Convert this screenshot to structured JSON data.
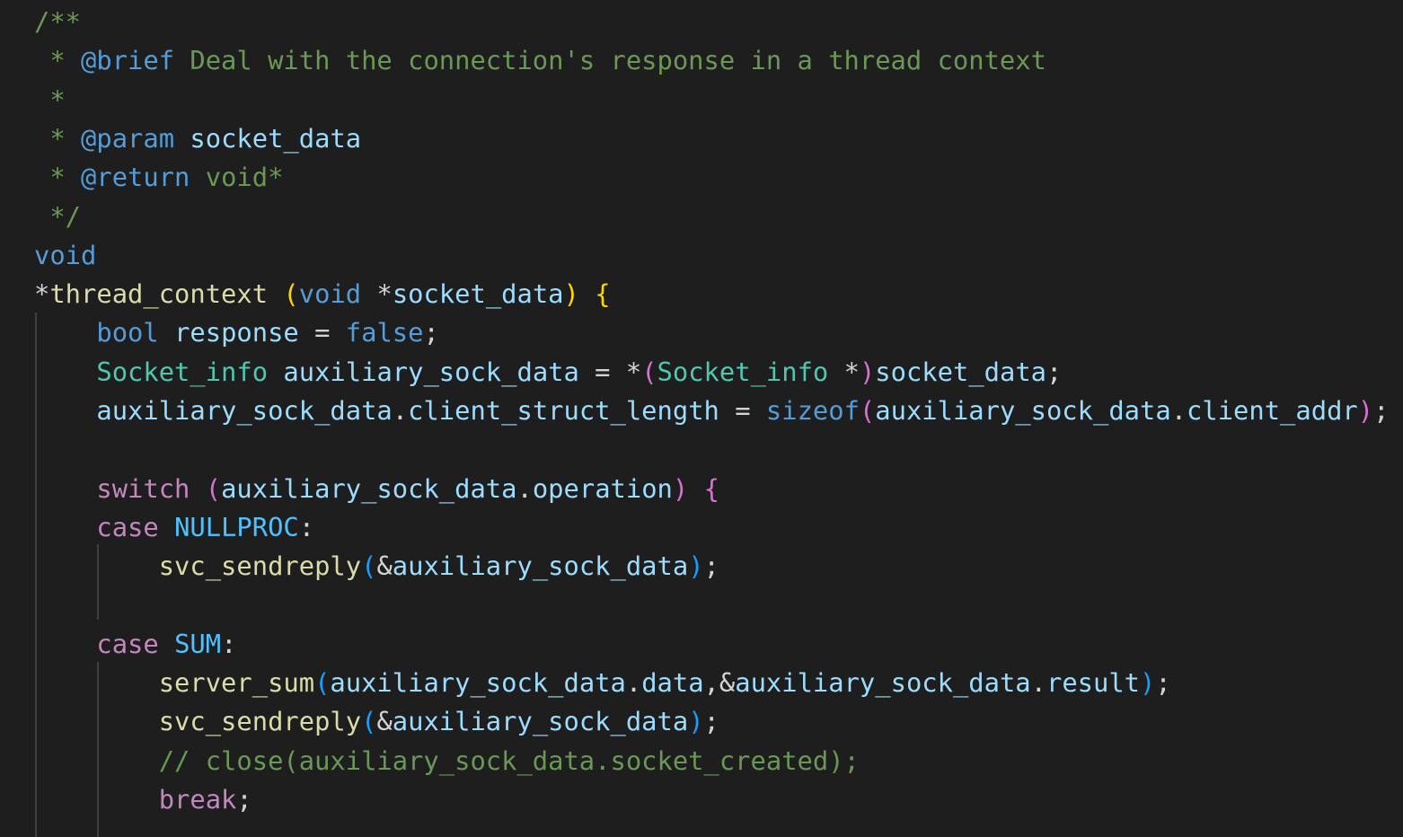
{
  "editor": {
    "colors": {
      "background": "#1e1e1e",
      "comment": "#6a9955",
      "doc_tag": "#569cd6",
      "doc_param": "#9cdcfe",
      "keyword": "#569cd6",
      "control": "#c586c0",
      "type": "#4ec9b0",
      "function": "#dcdcaa",
      "variable": "#9cdcfe",
      "constant": "#4fc1ff",
      "punctuation": "#d4d4d4",
      "bracket_gold": "#ffd700",
      "bracket_purple": "#da70d6",
      "bracket_blue": "#179fff",
      "indent_guide": "#404040"
    },
    "lines": [
      [
        {
          "t": "/**",
          "c": "comment"
        }
      ],
      [
        {
          "t": " * ",
          "c": "comment"
        },
        {
          "t": "@brief",
          "c": "doc_tag"
        },
        {
          "t": " Deal with the connection's response in a thread context",
          "c": "comment"
        }
      ],
      [
        {
          "t": " *",
          "c": "comment"
        }
      ],
      [
        {
          "t": " * ",
          "c": "comment"
        },
        {
          "t": "@param",
          "c": "doc_tag"
        },
        {
          "t": " ",
          "c": "comment"
        },
        {
          "t": "socket_data",
          "c": "doc_param"
        }
      ],
      [
        {
          "t": " * ",
          "c": "comment"
        },
        {
          "t": "@return",
          "c": "doc_tag"
        },
        {
          "t": " void*",
          "c": "comment"
        }
      ],
      [
        {
          "t": " */",
          "c": "comment"
        }
      ],
      [
        {
          "t": "void",
          "c": "keyword"
        }
      ],
      [
        {
          "t": "*",
          "c": "punctuation"
        },
        {
          "t": "thread_context",
          "c": "function"
        },
        {
          "t": " ",
          "c": "punctuation"
        },
        {
          "t": "(",
          "c": "bracket_gold"
        },
        {
          "t": "void",
          "c": "keyword"
        },
        {
          "t": " *",
          "c": "punctuation"
        },
        {
          "t": "socket_data",
          "c": "variable"
        },
        {
          "t": ")",
          "c": "bracket_gold"
        },
        {
          "t": " ",
          "c": "punctuation"
        },
        {
          "t": "{",
          "c": "bracket_gold"
        }
      ],
      [
        {
          "t": "    ",
          "c": "punctuation"
        },
        {
          "t": "bool",
          "c": "keyword"
        },
        {
          "t": " ",
          "c": "punctuation"
        },
        {
          "t": "response",
          "c": "variable"
        },
        {
          "t": " = ",
          "c": "punctuation"
        },
        {
          "t": "false",
          "c": "keyword"
        },
        {
          "t": ";",
          "c": "punctuation"
        }
      ],
      [
        {
          "t": "    ",
          "c": "punctuation"
        },
        {
          "t": "Socket_info",
          "c": "type"
        },
        {
          "t": " ",
          "c": "punctuation"
        },
        {
          "t": "auxiliary_sock_data",
          "c": "variable"
        },
        {
          "t": " = *",
          "c": "punctuation"
        },
        {
          "t": "(",
          "c": "bracket_purple"
        },
        {
          "t": "Socket_info",
          "c": "type"
        },
        {
          "t": " *",
          "c": "punctuation"
        },
        {
          "t": ")",
          "c": "bracket_purple"
        },
        {
          "t": "socket_data",
          "c": "variable"
        },
        {
          "t": ";",
          "c": "punctuation"
        }
      ],
      [
        {
          "t": "    ",
          "c": "punctuation"
        },
        {
          "t": "auxiliary_sock_data",
          "c": "variable"
        },
        {
          "t": ".",
          "c": "punctuation"
        },
        {
          "t": "client_struct_length",
          "c": "variable"
        },
        {
          "t": " = ",
          "c": "punctuation"
        },
        {
          "t": "sizeof",
          "c": "keyword"
        },
        {
          "t": "(",
          "c": "bracket_purple"
        },
        {
          "t": "auxiliary_sock_data",
          "c": "variable"
        },
        {
          "t": ".",
          "c": "punctuation"
        },
        {
          "t": "client_addr",
          "c": "variable"
        },
        {
          "t": ")",
          "c": "bracket_purple"
        },
        {
          "t": ";",
          "c": "punctuation"
        }
      ],
      [],
      [
        {
          "t": "    ",
          "c": "punctuation"
        },
        {
          "t": "switch",
          "c": "control"
        },
        {
          "t": " ",
          "c": "punctuation"
        },
        {
          "t": "(",
          "c": "bracket_purple"
        },
        {
          "t": "auxiliary_sock_data",
          "c": "variable"
        },
        {
          "t": ".",
          "c": "punctuation"
        },
        {
          "t": "operation",
          "c": "variable"
        },
        {
          "t": ")",
          "c": "bracket_purple"
        },
        {
          "t": " ",
          "c": "punctuation"
        },
        {
          "t": "{",
          "c": "bracket_purple"
        }
      ],
      [
        {
          "t": "    ",
          "c": "punctuation"
        },
        {
          "t": "case",
          "c": "control"
        },
        {
          "t": " ",
          "c": "punctuation"
        },
        {
          "t": "NULLPROC",
          "c": "constant"
        },
        {
          "t": ":",
          "c": "punctuation"
        }
      ],
      [
        {
          "t": "        ",
          "c": "punctuation"
        },
        {
          "t": "svc_sendreply",
          "c": "function"
        },
        {
          "t": "(",
          "c": "bracket_blue"
        },
        {
          "t": "&",
          "c": "punctuation"
        },
        {
          "t": "auxiliary_sock_data",
          "c": "variable"
        },
        {
          "t": ")",
          "c": "bracket_blue"
        },
        {
          "t": ";",
          "c": "punctuation"
        }
      ],
      [],
      [
        {
          "t": "    ",
          "c": "punctuation"
        },
        {
          "t": "case",
          "c": "control"
        },
        {
          "t": " ",
          "c": "punctuation"
        },
        {
          "t": "SUM",
          "c": "constant"
        },
        {
          "t": ":",
          "c": "punctuation"
        }
      ],
      [
        {
          "t": "        ",
          "c": "punctuation"
        },
        {
          "t": "server_sum",
          "c": "function"
        },
        {
          "t": "(",
          "c": "bracket_blue"
        },
        {
          "t": "auxiliary_sock_data",
          "c": "variable"
        },
        {
          "t": ".",
          "c": "punctuation"
        },
        {
          "t": "data",
          "c": "variable"
        },
        {
          "t": ",&",
          "c": "punctuation"
        },
        {
          "t": "auxiliary_sock_data",
          "c": "variable"
        },
        {
          "t": ".",
          "c": "punctuation"
        },
        {
          "t": "result",
          "c": "variable"
        },
        {
          "t": ")",
          "c": "bracket_blue"
        },
        {
          "t": ";",
          "c": "punctuation"
        }
      ],
      [
        {
          "t": "        ",
          "c": "punctuation"
        },
        {
          "t": "svc_sendreply",
          "c": "function"
        },
        {
          "t": "(",
          "c": "bracket_blue"
        },
        {
          "t": "&",
          "c": "punctuation"
        },
        {
          "t": "auxiliary_sock_data",
          "c": "variable"
        },
        {
          "t": ")",
          "c": "bracket_blue"
        },
        {
          "t": ";",
          "c": "punctuation"
        }
      ],
      [
        {
          "t": "        ",
          "c": "punctuation"
        },
        {
          "t": "// close(auxiliary_sock_data.socket_created);",
          "c": "comment"
        }
      ],
      [
        {
          "t": "        ",
          "c": "punctuation"
        },
        {
          "t": "break",
          "c": "control"
        },
        {
          "t": ";",
          "c": "punctuation"
        }
      ]
    ]
  }
}
